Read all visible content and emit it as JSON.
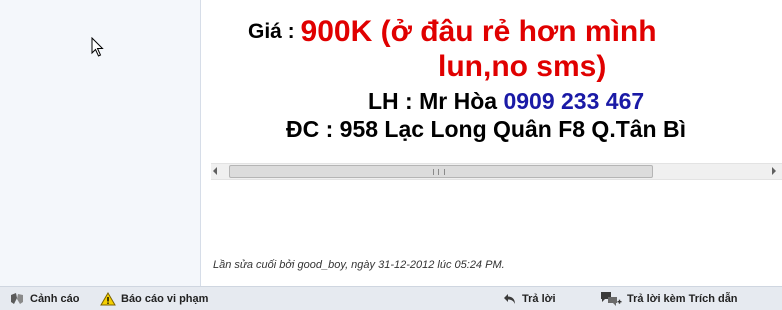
{
  "post": {
    "price_label": "Giá :",
    "price_value": "900K (ở đâu rẻ hơn mình",
    "price_cont": "lun,no sms)",
    "contact_label": "LH : Mr Hòa",
    "contact_phone": "0909 233 467",
    "address": "ĐC : 958 Lạc Long Quân F8 Q.Tân Bì",
    "edited_note": "Lần sửa cuối bởi good_boy, ngày 31-12-2012 lúc 05:24 PM."
  },
  "actions": {
    "warn_label": "Cảnh cáo",
    "report_label": "Báo cáo vi phạm",
    "reply_label": "Trả lời",
    "quote_reply_label": "Trả lời kèm Trích dẫn"
  },
  "colors": {
    "price": "#e00000",
    "phone": "#1a1aa6"
  },
  "icons": {
    "cursor": "mouse-cursor-icon",
    "warn": "warning-hands-icon",
    "report": "alert-triangle-icon",
    "reply": "reply-arrow-icon",
    "quote": "quote-reply-icon"
  }
}
